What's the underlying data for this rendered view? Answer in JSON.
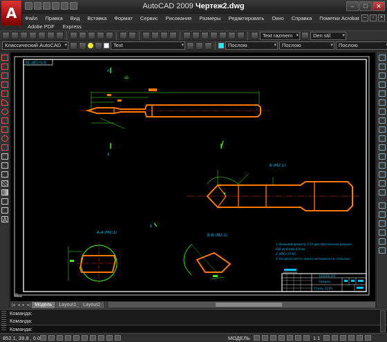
{
  "app": {
    "title_app": "AutoCAD 2009",
    "title_doc": "Чертеж2.dwg"
  },
  "menu": [
    {
      "label": "Файл"
    },
    {
      "label": "Правка"
    },
    {
      "label": "Вид"
    },
    {
      "label": "Вставка"
    },
    {
      "label": "Формат"
    },
    {
      "label": "Сервис"
    },
    {
      "label": "Рисование"
    },
    {
      "label": "Размеры"
    },
    {
      "label": "Редактировать"
    },
    {
      "label": "Окно"
    },
    {
      "label": "Справка"
    },
    {
      "label": "Пометки Acrobat"
    }
  ],
  "menu2": [
    {
      "label": "Adobe PDF"
    },
    {
      "label": "Express"
    }
  ],
  "toolbar": {
    "text_style": "Text razmern",
    "dim_style": "Den stil"
  },
  "toolbar2": {
    "workspace": "Классический AutoCAD",
    "layer": "Text",
    "color": "Послою",
    "linetype": "Послою",
    "lineweight": "Послою"
  },
  "drawing": {
    "stamp_top": "ЕЕ-ОЕ7/5/Е",
    "section_b": "Б (М2:1)",
    "section_aa": "A-A (M2:1)",
    "section_bb": "Б-Б (М2:1)",
    "label_a": "А",
    "label_b": "Б",
    "notes": [
      "1. Внешний диаметр 3.5h для обеспечения допуска",
      "   Rz6 не более 0,8 мм",
      "2. HRCэ 55-60.",
      "3. Не допускается замена материала на стальные"
    ],
    "tb_code": "ЕЕЕ/ЕЕ-Е4",
    "tb_name": "Сверло",
    "tb_material": "Сталь 11Х5",
    "colors": {
      "part": "#ff7a00",
      "dim": "#39ff14",
      "center": "#ff2a2a",
      "text": "#00bfff",
      "frame": "#ffffff"
    }
  },
  "tabs": [
    {
      "label": "Модель"
    },
    {
      "label": "Layout1"
    },
    {
      "label": "Layout2"
    }
  ],
  "command": {
    "lines": [
      "Команда:",
      "Команда:",
      "Команда:"
    ]
  },
  "status": {
    "coords": "852.1, 39.8 , 0.0",
    "model_label": "МОДЕЛЬ",
    "scale": "1:1"
  }
}
